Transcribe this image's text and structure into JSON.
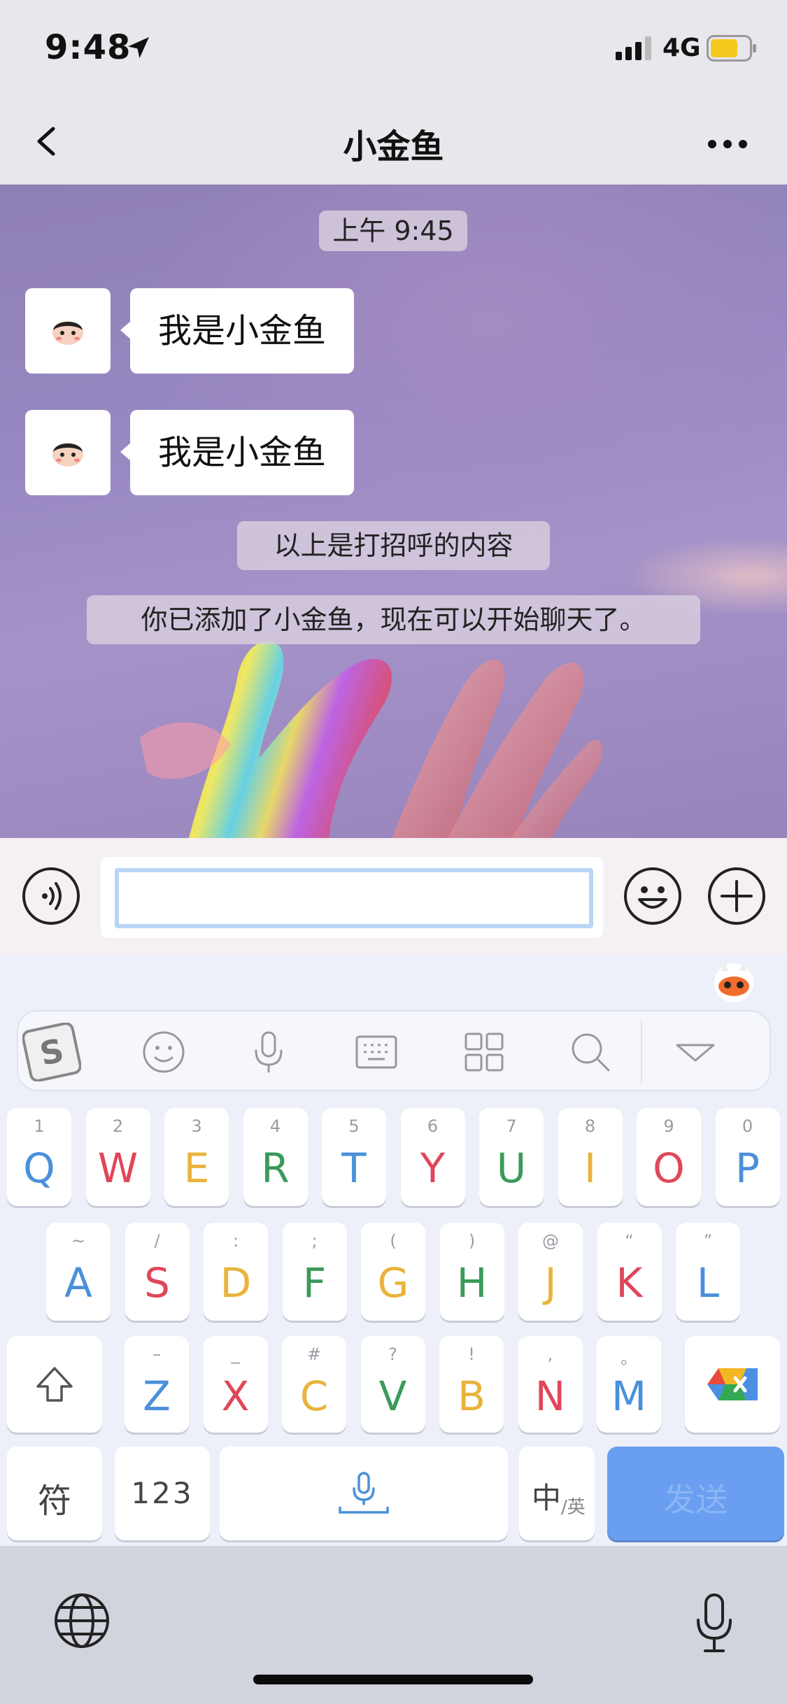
{
  "status_bar": {
    "time": "9:48",
    "network": "4G"
  },
  "nav": {
    "title": "小金鱼"
  },
  "chat": {
    "timestamp": "上午 9:45",
    "messages": [
      {
        "text": "我是小金鱼"
      },
      {
        "text": "我是小金鱼"
      }
    ],
    "system_messages": [
      "以上是打招呼的内容",
      "你已添加了小金鱼，现在可以开始聊天了。"
    ]
  },
  "input": {
    "value": ""
  },
  "keyboard": {
    "row1": [
      {
        "sub": "1",
        "key": "Q",
        "color": "#4a90d9"
      },
      {
        "sub": "2",
        "key": "W",
        "color": "#e0465a"
      },
      {
        "sub": "3",
        "key": "E",
        "color": "#e9b33c"
      },
      {
        "sub": "4",
        "key": "R",
        "color": "#3a9a5a"
      },
      {
        "sub": "5",
        "key": "T",
        "color": "#4a90d9"
      },
      {
        "sub": "6",
        "key": "Y",
        "color": "#e0465a"
      },
      {
        "sub": "7",
        "key": "U",
        "color": "#3a9a5a"
      },
      {
        "sub": "8",
        "key": "I",
        "color": "#e9b33c"
      },
      {
        "sub": "9",
        "key": "O",
        "color": "#e0465a"
      },
      {
        "sub": "0",
        "key": "P",
        "color": "#4a90d9"
      }
    ],
    "row2": [
      {
        "sub": "~",
        "key": "A",
        "color": "#4a90d9"
      },
      {
        "sub": "/",
        "key": "S",
        "color": "#e0465a"
      },
      {
        "sub": ":",
        "key": "D",
        "color": "#e9b33c"
      },
      {
        "sub": ";",
        "key": "F",
        "color": "#3a9a5a"
      },
      {
        "sub": "(",
        "key": "G",
        "color": "#e9b33c"
      },
      {
        "sub": ")",
        "key": "H",
        "color": "#3a9a5a"
      },
      {
        "sub": "@",
        "key": "J",
        "color": "#e9b33c"
      },
      {
        "sub": "“",
        "key": "K",
        "color": "#e0465a"
      },
      {
        "sub": "”",
        "key": "L",
        "color": "#4a90d9"
      }
    ],
    "row3": [
      {
        "sub": "–",
        "key": "Z",
        "color": "#4a90d9"
      },
      {
        "sub": "_",
        "key": "X",
        "color": "#e0465a"
      },
      {
        "sub": "#",
        "key": "C",
        "color": "#e9b33c"
      },
      {
        "sub": "?",
        "key": "V",
        "color": "#3a9a5a"
      },
      {
        "sub": "!",
        "key": "B",
        "color": "#e9b33c"
      },
      {
        "sub": ",",
        "key": "N",
        "color": "#e0465a"
      },
      {
        "sub": "。",
        "key": "M",
        "color": "#4a90d9"
      }
    ],
    "symbols_label": "符",
    "numbers_label": "123",
    "lang_main": "中",
    "lang_sub": "/英",
    "send_label": "发送",
    "send_color": "#6a9ef0"
  }
}
